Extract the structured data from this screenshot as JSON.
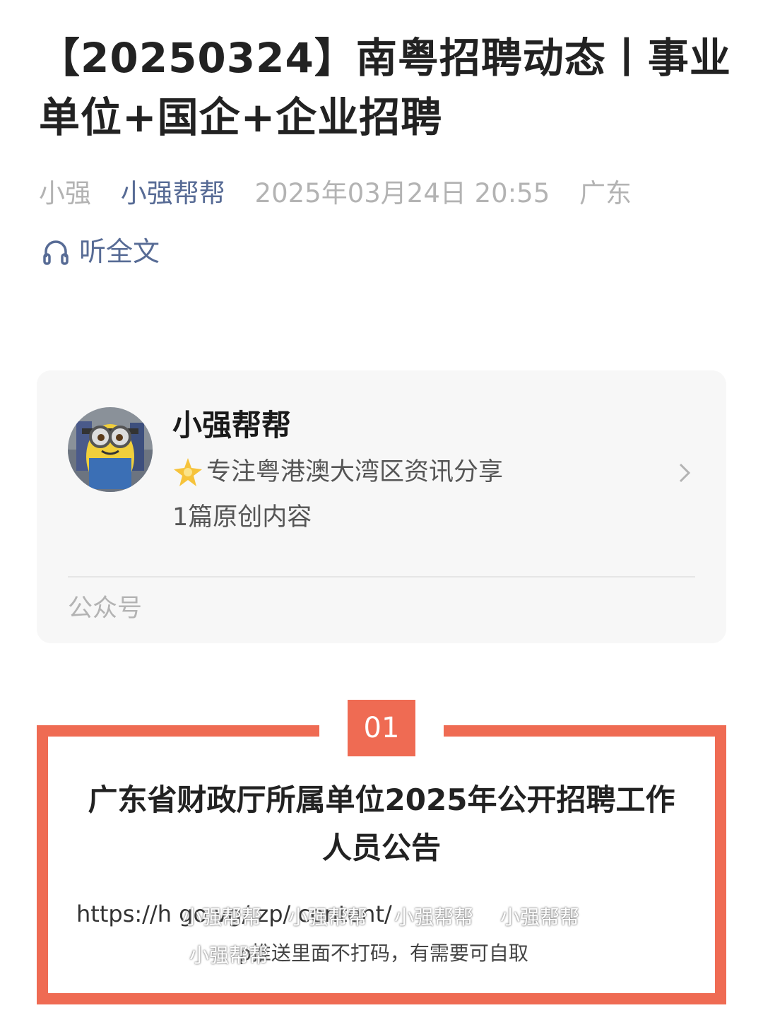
{
  "article": {
    "title": "【20250324】南粤招聘动态丨事业单位+国企+企业招聘",
    "author": "小强",
    "account": "小强帮帮",
    "datetime": "2025年03月24日 20:55",
    "location": "广东",
    "listen_label": "听全文"
  },
  "profile_card": {
    "name": "小强帮帮",
    "description": "专注粤港澳大湾区资讯分享",
    "original_count": "1篇原创内容",
    "type_label": "公众号"
  },
  "section": {
    "number": "01",
    "title": "广东省财政厅所属单位2025年公开招聘工作人员公告",
    "url_text": "https://h        go         vg/        zp/        content/",
    "note_text": "     p推送里面不打码，有需要可自取",
    "watermark": "小强帮帮"
  },
  "colors": {
    "accent": "#ef6b53",
    "link": "#576b95",
    "muted": "#b3b3b3"
  }
}
